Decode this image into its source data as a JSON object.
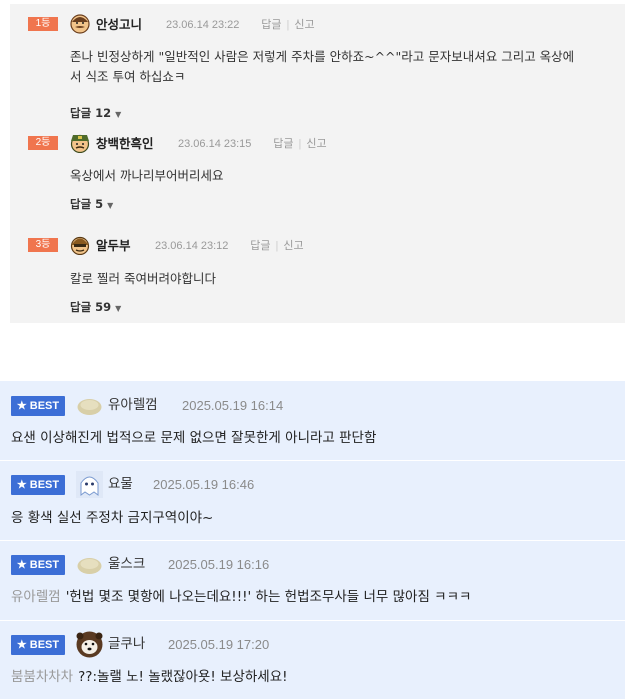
{
  "comments_top": [
    {
      "rank": "1등",
      "nick": "안성고니",
      "date": "23.06.14 23:22",
      "reply": "답글",
      "report": "신고",
      "lines": [
        "존나 빈정상하게 \"일반적인 사람은 저렇게 주차를 안하죠~^^\"라고 문자보내셔요 그리고 옥상에",
        "서 식조 투여 하십쇼ㅋ"
      ],
      "reply_count_label": "답글 12",
      "avatar": "mustache-face-icon"
    },
    {
      "rank": "2등",
      "nick": "창백한흑인",
      "date": "23.06.14 23:15",
      "reply": "답글",
      "report": "신고",
      "lines": [
        "옥상에서 까나리부어버리세요"
      ],
      "reply_count_label": "답글 5",
      "avatar": "soldier-face-icon"
    },
    {
      "rank": "3등",
      "nick": "알두부",
      "date": "23.06.14 23:12",
      "reply": "답글",
      "report": "신고",
      "lines": [
        "칼로 찔러 죽여버려야합니다"
      ],
      "reply_count_label": "답글 59",
      "avatar": "helmet-face-icon"
    }
  ],
  "best_comments": [
    {
      "badge": "★ BEST",
      "nick": "유아렐껌",
      "date": "2025.05.19 16:14",
      "mention": "",
      "text": "요샌 이상해진게 법적으로 문제 없으면 잘못한게 아니라고 판단함",
      "avatar": "blob-icon"
    },
    {
      "badge": "★ BEST",
      "nick": "요물",
      "date": "2025.05.19 16:46",
      "mention": "",
      "text": "응 황색 실선 주정차 금지구역이야~",
      "avatar": "ghost-icon"
    },
    {
      "badge": "★ BEST",
      "nick": "울스크",
      "date": "2025.05.19 16:16",
      "mention": "유아렐껌",
      "text": "'헌법 몇조 몇항에 나오는데요!!!' 하는 헌법조무사들 너무 많아짐 ㅋㅋㅋ",
      "avatar": "blob-icon"
    },
    {
      "badge": "★ BEST",
      "nick": "글쿠나",
      "date": "2025.05.19 17:20",
      "mention": "붐붐차차차",
      "text": "??:놀랠 노! 놀랬잖아욧! 보상하세요!",
      "avatar": "bear-icon"
    }
  ],
  "colors": {
    "rank_bg": "#f0754e",
    "best_badge": "#3c6ed6",
    "best_bg": "#e8f0fd",
    "top_bg": "#f3f3f3"
  }
}
